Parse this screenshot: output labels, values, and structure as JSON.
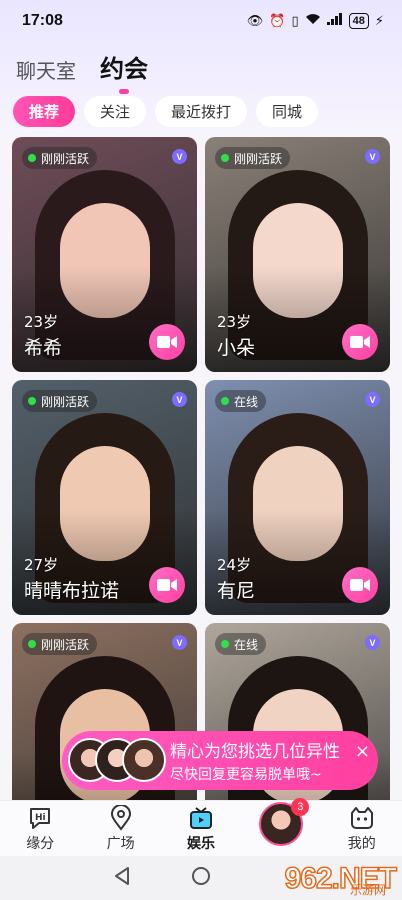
{
  "status_bar": {
    "time": "17:08",
    "battery": "48"
  },
  "top_tabs": [
    {
      "label": "聊天室",
      "active": false
    },
    {
      "label": "约会",
      "active": true
    }
  ],
  "filter_chips": [
    {
      "label": "推荐",
      "active": true
    },
    {
      "label": "关注",
      "active": false
    },
    {
      "label": "最近拨打",
      "active": false
    },
    {
      "label": "同城",
      "active": false
    }
  ],
  "cards": [
    {
      "status": "刚刚活跃",
      "age": "23岁",
      "name": "希希",
      "verified": "V",
      "bg": "#6e4c58",
      "hair": "#2a1a1c",
      "face": "#f1c6b6"
    },
    {
      "status": "刚刚活跃",
      "age": "23岁",
      "name": "小朵",
      "verified": "V",
      "bg": "#8a8077",
      "hair": "#231915",
      "face": "#f4d8cc"
    },
    {
      "status": "刚刚活跃",
      "age": "27岁",
      "name": "晴晴布拉诺",
      "verified": "V",
      "bg": "#53606a",
      "hair": "#261a14",
      "face": "#efc9b2"
    },
    {
      "status": "在线",
      "age": "24岁",
      "name": "有尼",
      "verified": "V",
      "bg": "#7e8fb0",
      "hair": "#2a1d18",
      "face": "#f0d2c0"
    },
    {
      "status": "刚刚活跃",
      "age": "",
      "name": "",
      "verified": "V",
      "bg": "#8d7060",
      "hair": "#1f1411",
      "face": "#e9bfa4"
    },
    {
      "status": "在线",
      "age": "",
      "name": "",
      "verified": "V",
      "bg": "#b0a79c",
      "hair": "#1c1512",
      "face": "#f1d3c3"
    }
  ],
  "promo": {
    "line1": "精心为您挑选几位异性",
    "line2": "尽快回复更容易脱单哦~",
    "close": "×"
  },
  "bottom_nav": [
    {
      "label": "缘分",
      "icon": "hi-icon"
    },
    {
      "label": "广场",
      "icon": "location-pin-icon"
    },
    {
      "label": "娱乐",
      "icon": "tv-icon",
      "active": true
    },
    {
      "label": "",
      "icon": "avatar",
      "badge": "3"
    },
    {
      "label": "我的",
      "icon": "face-icon"
    }
  ],
  "watermark": {
    "logo": "962.NET",
    "sub": "乐游网"
  },
  "colors": {
    "accent": "#ff3ea5",
    "verified": "#7d6cff",
    "online": "#2fe04a"
  }
}
